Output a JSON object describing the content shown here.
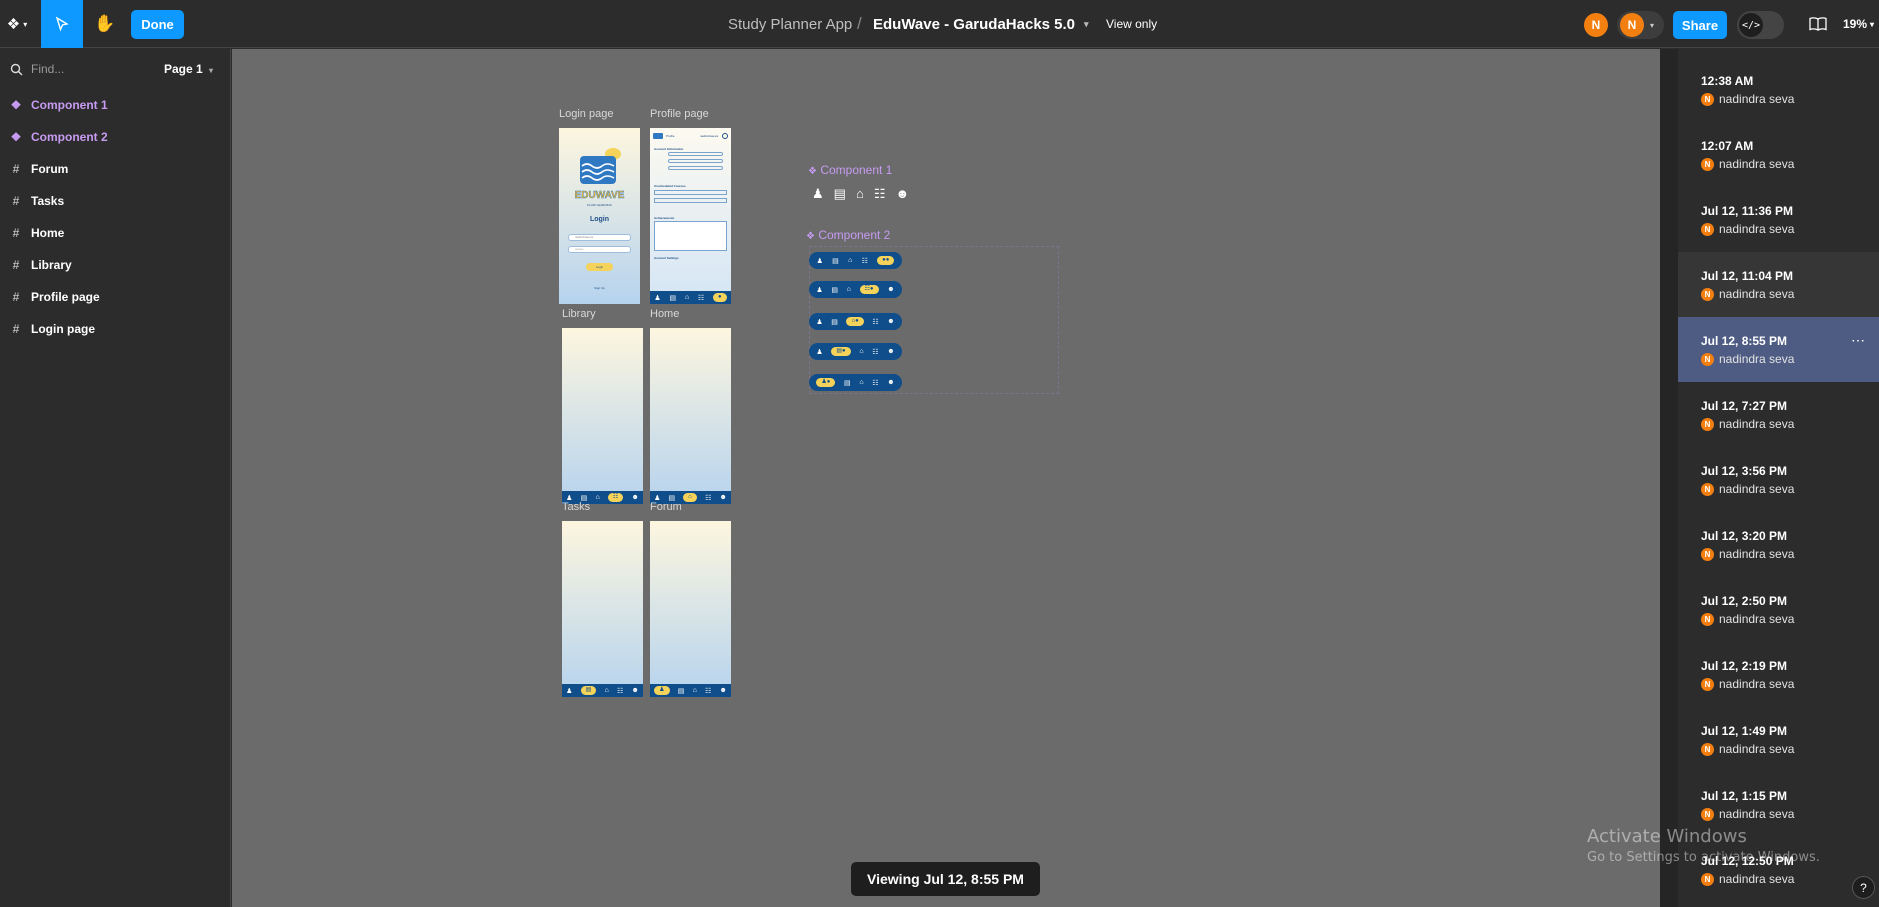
{
  "toolbar": {
    "menu_icon": "figma-logo-icon",
    "done_label": "Done",
    "breadcrumb_project": "Study Planner App",
    "breadcrumb_sep": "/",
    "file_name": "EduWave - GarudaHacks 5.0",
    "view_mode": "View only",
    "avatar_1": "N",
    "avatar_2": "N",
    "share_label": "Share",
    "zoom": "19%"
  },
  "layers_panel": {
    "find_placeholder": "Find...",
    "page_name": "Page 1",
    "items": [
      {
        "label": "Component 1",
        "kind": "component"
      },
      {
        "label": "Component 2",
        "kind": "component"
      },
      {
        "label": "Forum",
        "kind": "frame"
      },
      {
        "label": "Tasks",
        "kind": "frame"
      },
      {
        "label": "Home",
        "kind": "frame"
      },
      {
        "label": "Library",
        "kind": "frame"
      },
      {
        "label": "Profile page",
        "kind": "frame"
      },
      {
        "label": "Login page",
        "kind": "frame"
      }
    ]
  },
  "canvas": {
    "frames": {
      "login": "Login page",
      "profile": "Profile page",
      "library": "Library",
      "home": "Home",
      "tasks": "Tasks",
      "forum": "Forum"
    },
    "login_page": {
      "logo_text": "EDUWAVE",
      "tagline": "FLOW LEARNING",
      "heading": "Login",
      "username_value": "nadindraseva",
      "password_value": "••••••••",
      "button": "Login",
      "signup": "Sign Up"
    },
    "profile_page": {
      "header": "Profile",
      "username": "nadindraseva",
      "section_account": "Account Information",
      "section_courses": "Unscheduled Courses",
      "section_achievements": "Achievements",
      "section_settings": "Account Settings"
    },
    "component_1_label": "Component 1",
    "component_2_label": "Component 2",
    "nav_pill_text": "Home"
  },
  "history": {
    "versions": [
      {
        "time": "12:38 AM",
        "user": "nadindra seva"
      },
      {
        "time": "12:07 AM",
        "user": "nadindra seva"
      },
      {
        "time": "Jul 12, 11:36 PM",
        "user": "nadindra seva"
      },
      {
        "time": "Jul 12, 11:04 PM",
        "user": "nadindra seva"
      },
      {
        "time": "Jul 12, 8:55 PM",
        "user": "nadindra seva"
      },
      {
        "time": "Jul 12, 7:27 PM",
        "user": "nadindra seva"
      },
      {
        "time": "Jul 12, 3:56 PM",
        "user": "nadindra seva"
      },
      {
        "time": "Jul 12, 3:20 PM",
        "user": "nadindra seva"
      },
      {
        "time": "Jul 12, 2:50 PM",
        "user": "nadindra seva"
      },
      {
        "time": "Jul 12, 2:19 PM",
        "user": "nadindra seva"
      },
      {
        "time": "Jul 12, 1:49 PM",
        "user": "nadindra seva"
      },
      {
        "time": "Jul 12, 1:15 PM",
        "user": "nadindra seva"
      },
      {
        "time": "Jul 12, 12:50 PM",
        "user": "nadindra seva"
      }
    ],
    "avatar_letter": "N",
    "selected_index": 4,
    "more_icon": "⋯"
  },
  "toast": "Viewing Jul 12, 8:55 PM",
  "watermark": {
    "title": "Activate Windows",
    "subtitle": "Go to Settings to activate Windows."
  },
  "help": "?",
  "colors": {
    "accent": "#0d99ff",
    "component": "#c79bf2",
    "avatar": "#f37f10",
    "selected_version": "#4e5c84",
    "nav_blue": "#0f4e8a",
    "nav_pill": "#f5d35a"
  }
}
